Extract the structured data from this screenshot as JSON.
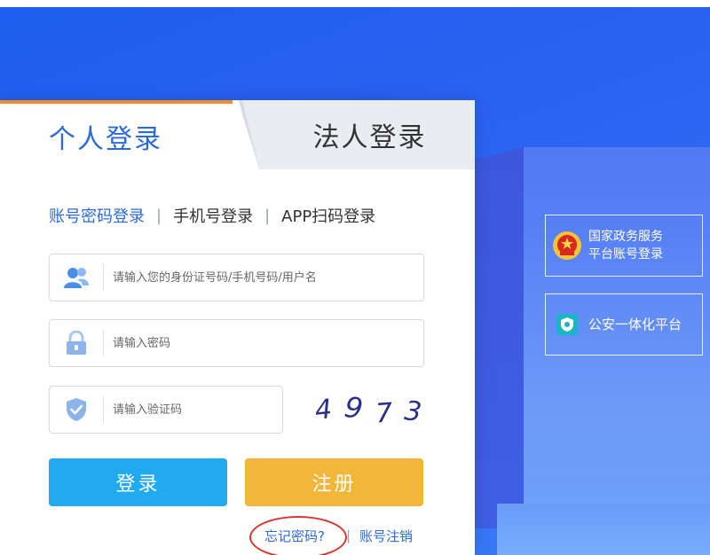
{
  "tabs": {
    "personal": "个人登录",
    "corporate": "法人登录"
  },
  "login_modes": {
    "password": "账号密码登录",
    "phone": "手机号登录",
    "app_scan": "APP扫码登录",
    "separator": "|"
  },
  "fields": {
    "username_placeholder": "请输入您的身份证号码/手机号码/用户名",
    "password_placeholder": "请输入密码",
    "captcha_placeholder": "请输入验证码"
  },
  "captcha": {
    "digits": [
      "4",
      "9",
      "7",
      "3"
    ]
  },
  "buttons": {
    "login": "登录",
    "register": "注册"
  },
  "links": {
    "forgot_password": "忘记密码?",
    "separator": "|",
    "cancel_account": "账号注销"
  },
  "side_panels": {
    "gov_line1": "国家政务服务",
    "gov_line2": "平台账号登录",
    "police": "公安一体化平台"
  },
  "colors": {
    "brand_blue": "#2b6bd9",
    "tab_accent": "#f08a2a",
    "login_button": "#22aaf0",
    "register_button": "#f2b63a",
    "highlight_ring": "#d8342d",
    "background": "#2a62f0"
  }
}
